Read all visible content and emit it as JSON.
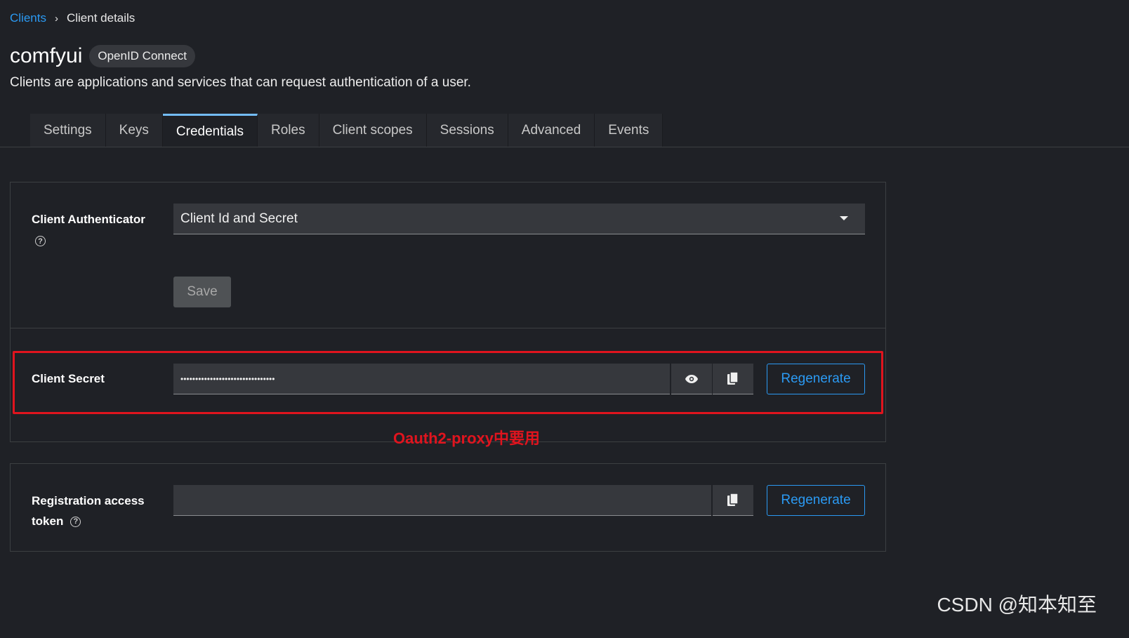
{
  "breadcrumb": {
    "parent": "Clients",
    "separator": "›",
    "current": "Client details"
  },
  "header": {
    "title": "comfyui",
    "badge": "OpenID Connect",
    "subtitle": "Clients are applications and services that can request authentication of a user."
  },
  "tabs": [
    {
      "label": "Settings",
      "active": false
    },
    {
      "label": "Keys",
      "active": false
    },
    {
      "label": "Credentials",
      "active": true
    },
    {
      "label": "Roles",
      "active": false
    },
    {
      "label": "Client scopes",
      "active": false
    },
    {
      "label": "Sessions",
      "active": false
    },
    {
      "label": "Advanced",
      "active": false
    },
    {
      "label": "Events",
      "active": false
    }
  ],
  "authenticator": {
    "label": "Client Authenticator",
    "help_icon": "?",
    "selected": "Client Id and Secret",
    "save_label": "Save"
  },
  "secret": {
    "label": "Client Secret",
    "value_masked": "••••••••••••••••••••••••••••••••",
    "show_icon": "eye-icon",
    "copy_icon": "copy-icon",
    "regenerate_label": "Regenerate"
  },
  "annotation": "Oauth2-proxy中要用",
  "registration": {
    "label_line1": "Registration access",
    "label_line2": "token",
    "help_icon": "?",
    "value": "",
    "copy_icon": "copy-icon",
    "regenerate_label": "Regenerate"
  },
  "watermark": "CSDN @知本知至",
  "colors": {
    "background": "#1f2126",
    "accent_link": "#2b9af3",
    "active_tab_border": "#73bcf7",
    "annotation_red": "#e0141e"
  }
}
